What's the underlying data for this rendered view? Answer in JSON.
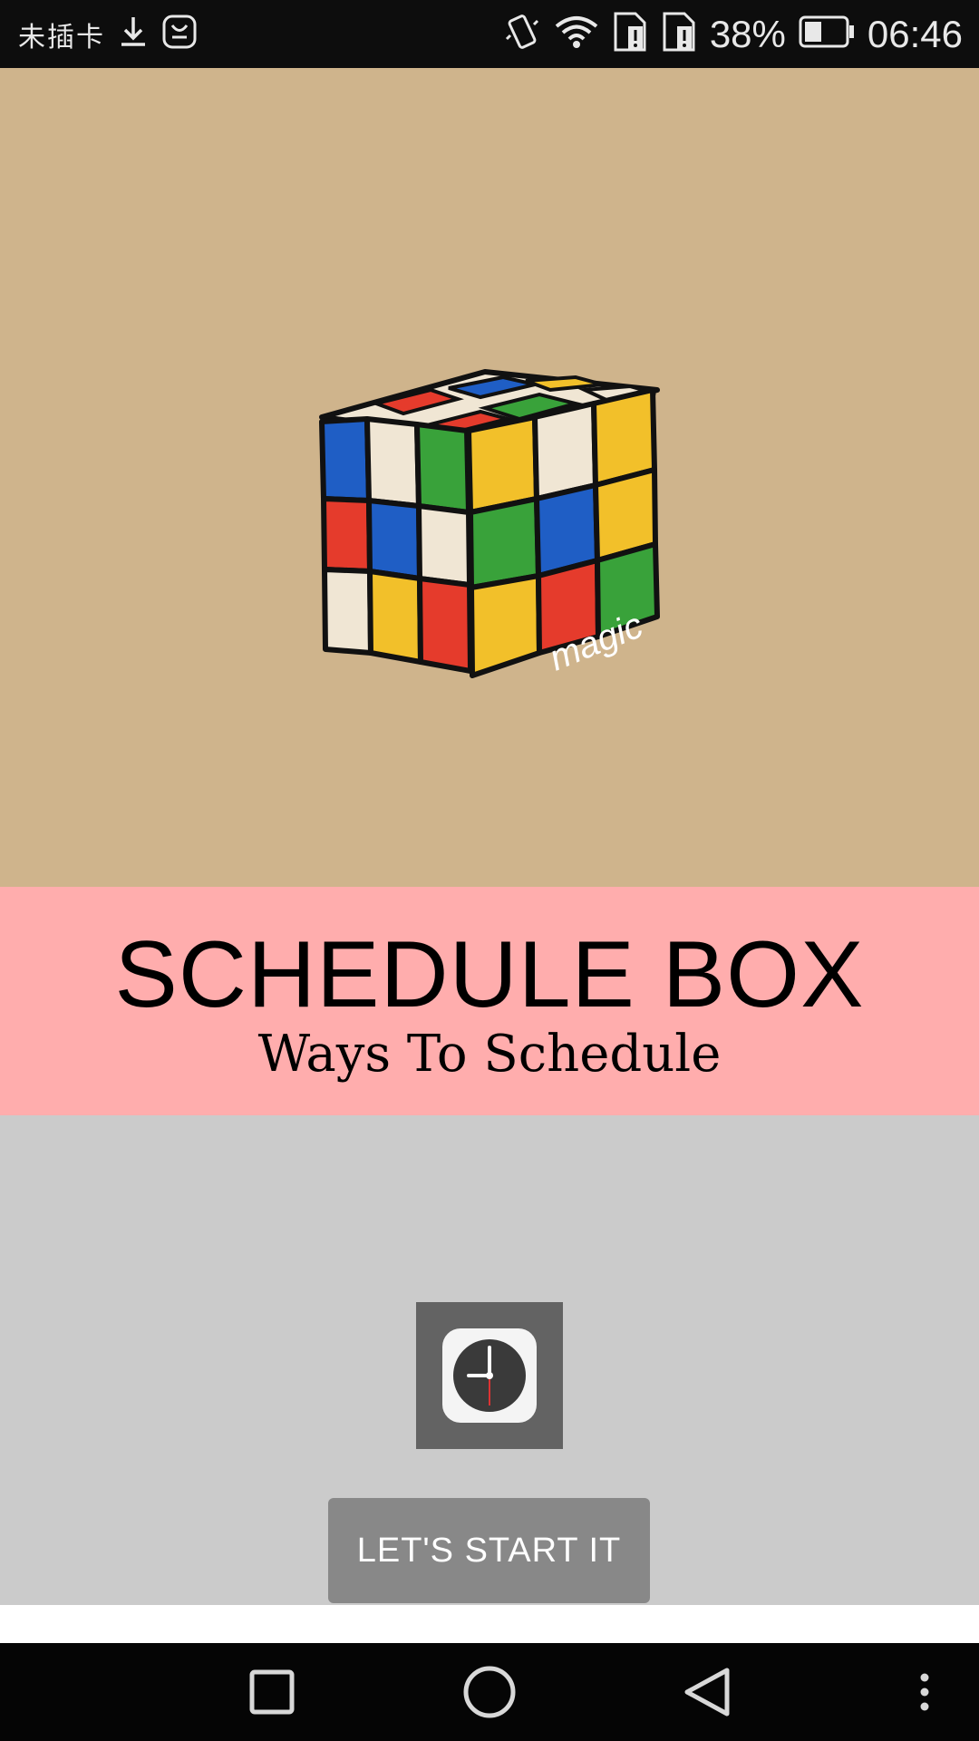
{
  "status_bar": {
    "carrier": "未插卡",
    "battery_percent": "38%",
    "time": "06:46",
    "icons": [
      "download-icon",
      "huawei-store-icon",
      "vibrate-icon",
      "wifi-icon",
      "sim-alert-icon",
      "sim-alert-icon",
      "battery-icon"
    ]
  },
  "hero": {
    "image": "rubiks-cube-illustration",
    "cube_caption": "magic",
    "background": "#cfb48c"
  },
  "banner": {
    "title": "SCHEDULE BOX",
    "subtitle": "Ways To Schedule",
    "background": "#ffadad"
  },
  "main": {
    "app_icon": "clock-icon",
    "start_button_label": "LET'S START IT",
    "background": "#cbcbcb"
  },
  "nav_bar": {
    "buttons": [
      "recent-apps-icon",
      "home-icon",
      "back-icon",
      "more-options-icon"
    ]
  }
}
